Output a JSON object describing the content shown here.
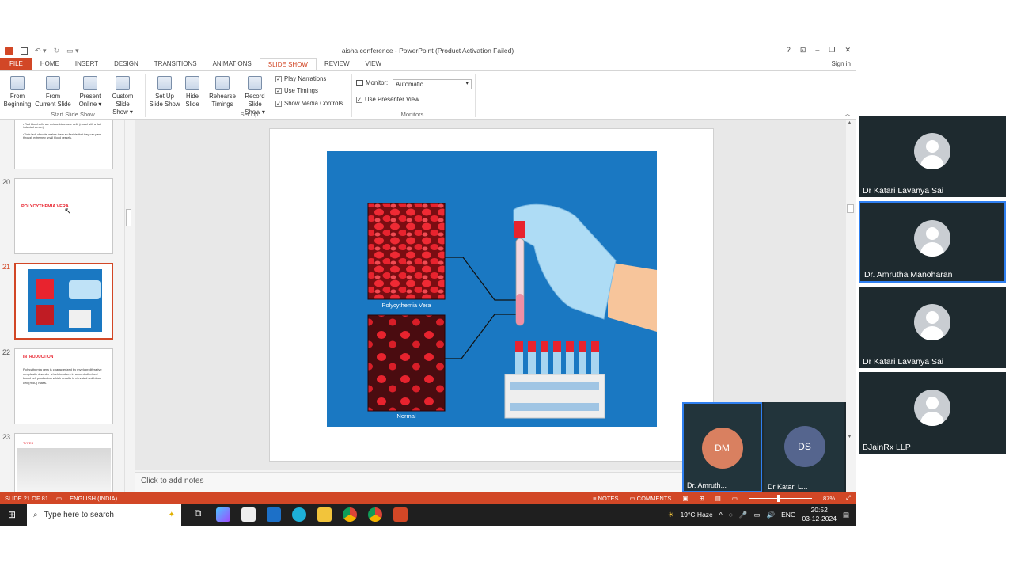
{
  "window": {
    "title": "aisha conference - PowerPoint (Product Activation Failed)",
    "help": "?",
    "sign_in": "Sign in"
  },
  "tabs": [
    "FILE",
    "HOME",
    "INSERT",
    "DESIGN",
    "TRANSITIONS",
    "ANIMATIONS",
    "SLIDE SHOW",
    "REVIEW",
    "VIEW"
  ],
  "active_tab": "SLIDE SHOW",
  "ribbon": {
    "from_beginning": [
      "From",
      "Beginning"
    ],
    "from_current": [
      "From",
      "Current Slide"
    ],
    "present_online": [
      "Present",
      "Online ▾"
    ],
    "custom_show": [
      "Custom Slide",
      "Show ▾"
    ],
    "group_start": "Start Slide Show",
    "set_up": [
      "Set Up",
      "Slide Show"
    ],
    "hide_slide": [
      "Hide",
      "Slide"
    ],
    "rehearse": [
      "Rehearse",
      "Timings"
    ],
    "record": [
      "Record Slide",
      "Show ▾"
    ],
    "play_narrations": "Play Narrations",
    "use_timings": "Use Timings",
    "show_media_controls": "Show Media Controls",
    "group_setup": "Set Up",
    "monitor_label": "Monitor:",
    "monitor_value": "Automatic",
    "use_presenter_view": "Use Presenter View",
    "group_monitors": "Monitors"
  },
  "thumbnails": {
    "t19_text": [
      "• Red blood cells are unique biconcave cells (round with a flat, indented center).",
      "•Their lack of nuclei makes them so flexible that they can pass through extremely small blood vessels."
    ],
    "t20_num": "20",
    "t20_title": "POLYCYTHEMIA VERA",
    "t21_num": "21",
    "t22_num": "22",
    "t22_title": "INTRODUCTION",
    "t22_body": "Polycythemia vera is characterized by myeloproliferative neoplastic disorder which involves in uncontrolled red blood cell production which results in elevated red blood cell (RBC) mass.",
    "t23_num": "23",
    "t23_title": "TYPES"
  },
  "slide": {
    "label_pv": "Polycythemia Vera",
    "label_normal": "Normal"
  },
  "notes_placeholder": "Click to add notes",
  "status": {
    "slide_of": "SLIDE 21 OF 81",
    "language": "ENGLISH (INDIA)",
    "notes": "NOTES",
    "comments": "COMMENTS",
    "zoom": "87%"
  },
  "taskbar": {
    "search_placeholder": "Type here to search",
    "weather": "19°C  Haze",
    "lang": "ENG",
    "time": "20:52",
    "date": "03-12-2024"
  },
  "participants": [
    {
      "name": "Dr Katari Lavanya Sai"
    },
    {
      "name": "Dr. Amrutha Manoharan"
    },
    {
      "name": "Dr Katari Lavanya Sai"
    },
    {
      "name": "BJainRx LLP"
    }
  ],
  "mini_participants": [
    {
      "initials": "DM",
      "name": "Dr. Amruth...",
      "color": "#d98060"
    },
    {
      "initials": "DS",
      "name": "Dr Katari L...",
      "color": "#55658e"
    }
  ],
  "colors": {
    "accent": "#d24726",
    "slide_bg": "#1a78c2",
    "blood": "#e8232e"
  }
}
